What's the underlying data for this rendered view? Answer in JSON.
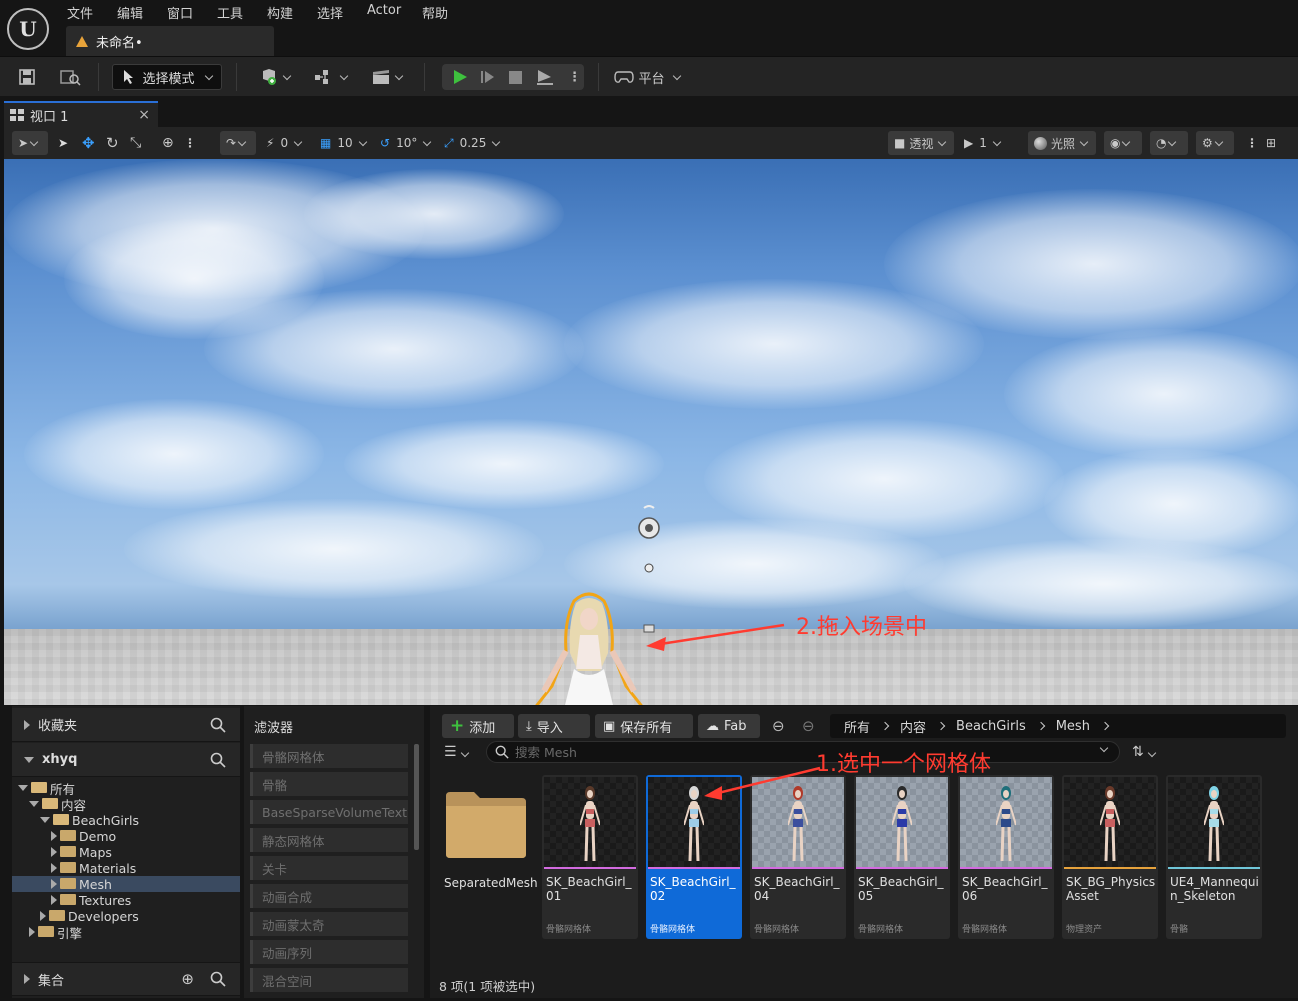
{
  "menubar": {
    "logo_icon": "unreal-engine-logo",
    "items": [
      "文件",
      "编辑",
      "窗口",
      "工具",
      "构建",
      "选择",
      "Actor",
      "帮助"
    ],
    "doc_tab": "未命名•"
  },
  "toolbar": {
    "mode_label": "选择模式",
    "platform_label": "平台"
  },
  "viewport_tab": {
    "label": "视口 1",
    "close": "×"
  },
  "viewport_toolbar": {
    "rotation_snap": "0",
    "grid_snap": "10",
    "angle_snap": "10°",
    "scale_snap": "0.25",
    "view_mode": "透视",
    "camera_speed": "1",
    "lighting": "光照"
  },
  "annotations": {
    "drag_hint": "2.拖入场景中",
    "select_hint": "1.选中一个网格体"
  },
  "content_browser": {
    "favorites_label": "收藏夹",
    "project_label": "xhyq",
    "tree": [
      {
        "label": "所有",
        "depth": 0,
        "open": true
      },
      {
        "label": "内容",
        "depth": 1,
        "open": true
      },
      {
        "label": "BeachGirls",
        "depth": 2,
        "open": true
      },
      {
        "label": "Demo",
        "depth": 3
      },
      {
        "label": "Maps",
        "depth": 3
      },
      {
        "label": "Materials",
        "depth": 3
      },
      {
        "label": "Mesh",
        "depth": 3,
        "selected": true
      },
      {
        "label": "Textures",
        "depth": 3
      },
      {
        "label": "Developers",
        "depth": 2
      },
      {
        "label": "引擎",
        "depth": 1
      }
    ],
    "collections_label": "集合",
    "filters_label": "滤波器",
    "filters": [
      "骨骼网格体",
      "骨骼",
      "BaseSparseVolumeText",
      "静态网格体",
      "关卡",
      "动画合成",
      "动画蒙太奇",
      "动画序列",
      "混合空间"
    ],
    "add_label": "添加",
    "import_label": "导入",
    "save_all_label": "保存所有",
    "fab_label": "Fab",
    "breadcrumb": [
      "所有",
      "内容",
      "BeachGirls",
      "Mesh"
    ],
    "search_placeholder": "搜索 Mesh",
    "folder_name": "SeparatedMesh",
    "assets": [
      {
        "name": "SK_BeachGirl_01",
        "type": "骨骼网格体",
        "strip": "#d36be0",
        "hair": "#5a3a2a",
        "outfit": "#c96060"
      },
      {
        "name": "SK_BeachGirl_02",
        "type": "骨骼网格体",
        "strip": "#d36be0",
        "hair": "#d6d6d6",
        "outfit": "#9ecde8",
        "selected": true
      },
      {
        "name": "SK_BeachGirl_04",
        "type": "骨骼网格体",
        "strip": "#d36be0",
        "hair": "#b03a2a",
        "outfit": "#3b4f9e",
        "grid": true
      },
      {
        "name": "SK_BeachGirl_05",
        "type": "骨骼网格体",
        "strip": "#d36be0",
        "hair": "#2a2a2a",
        "outfit": "#2a3aa8",
        "grid": true
      },
      {
        "name": "SK_BeachGirl_06",
        "type": "骨骼网格体",
        "strip": "#d36be0",
        "hair": "#1f6f7a",
        "outfit": "#2c4a8a",
        "grid": true
      },
      {
        "name": "SK_BG_PhysicsAsset",
        "type": "物理资产",
        "strip": "#e6a23c",
        "hair": "#6a3a2a",
        "outfit": "#c96060"
      },
      {
        "name": "UE4_Mannequin_Skeleton",
        "type": "骨骼",
        "strip": "#6fc6d9",
        "hair": "#7fd3e6",
        "outfit": "#a7dbe8"
      }
    ],
    "status": "8 项(1 项被选中)"
  }
}
